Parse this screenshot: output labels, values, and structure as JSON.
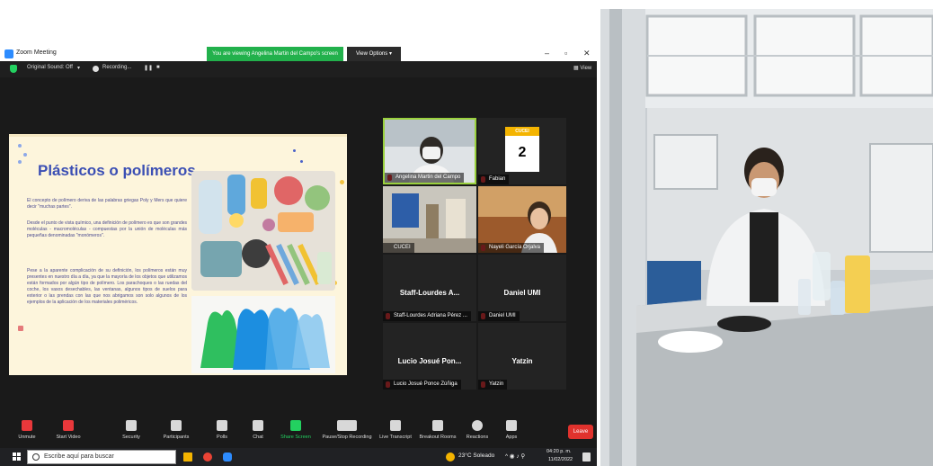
{
  "window": {
    "title": "Zoom Meeting",
    "share_banner": "You are viewing Angelina Martin del Campo's screen",
    "view_options": "View Options ▾",
    "minimize": "–",
    "maximize": "▫",
    "close": "✕"
  },
  "top_controls": {
    "original_sound": "Original Sound: Off",
    "dropdown": "▾",
    "recording": "Recording...",
    "pause": "❚❚",
    "stop": "■",
    "view": "View"
  },
  "slide": {
    "title": "Plásticos o polímeros",
    "paragraphs": [
      "El concepto de polímero deriva de las palabras griegas Poly y Mers que quiere decir \"muchas partes\".",
      "Desde el punto de vista químico, una definición de polímero es que son grandes moléculas - macromoléculas - compuestas por la unión de moléculas más pequeñas denominadas \"monómeros\".",
      "Pese a la aparente complicación de su definición, los polímeros están muy presentes en nuestro día a día, ya que la mayoría de los objetos que utilizamos están formados por algún tipo de polímero. Los parachoques o las ruedas del coche, los vasos desechables, las ventanas, algunos tipos de suelos para exterior o las prendas con las que nos abrigamos son solo algunos de los ejemplos de la aplicación de los materiales poliméricos."
    ]
  },
  "participants": [
    {
      "name": "Angelina Martin del Campo"
    },
    {
      "name": "Fabian",
      "logo_text": "CUCEI",
      "logo_number": "2"
    },
    {
      "name": "CUCEI"
    },
    {
      "name": "Nayeli García Orjalva"
    },
    {
      "name": "Staff-Lourdes Adriana Pérez ...",
      "big": "Staff-Lourdes A..."
    },
    {
      "name": "Daniel UMI",
      "big": "Daniel UMI"
    },
    {
      "name": "Lucio Josué Ponce Zúñiga",
      "big": "Lucio Josué Pon..."
    },
    {
      "name": "Yatzin",
      "big": "Yatzin"
    }
  ],
  "toolbar": [
    {
      "label": "Unmute",
      "icon": "mic-muted-icon"
    },
    {
      "label": "Start Video",
      "icon": "video-off-icon"
    },
    {
      "label": "Security",
      "icon": "shield-icon"
    },
    {
      "label": "Participants",
      "icon": "participants-icon",
      "count": "8"
    },
    {
      "label": "Polls",
      "icon": "polls-icon"
    },
    {
      "label": "Chat",
      "icon": "chat-icon"
    },
    {
      "label": "Share Screen",
      "icon": "share-screen-icon"
    },
    {
      "label": "Pause/Stop Recording",
      "icon": "record-controls-icon"
    },
    {
      "label": "Live Transcript",
      "icon": "cc-icon"
    },
    {
      "label": "Breakout Rooms",
      "icon": "breakout-icon"
    },
    {
      "label": "Reactions",
      "icon": "reactions-icon"
    },
    {
      "label": "Apps",
      "icon": "apps-icon"
    }
  ],
  "leave_label": "Leave",
  "taskbar": {
    "search_placeholder": "Escribe aquí para buscar",
    "weather": "23°C  Soleado",
    "time": "04:20 p. m.",
    "date": "11/02/2022"
  },
  "colors": {
    "share_green": "#22b14c",
    "leave_red": "#e0322d",
    "slide_title": "#3b4fb4",
    "zoom_blue": "#2d8cff"
  }
}
